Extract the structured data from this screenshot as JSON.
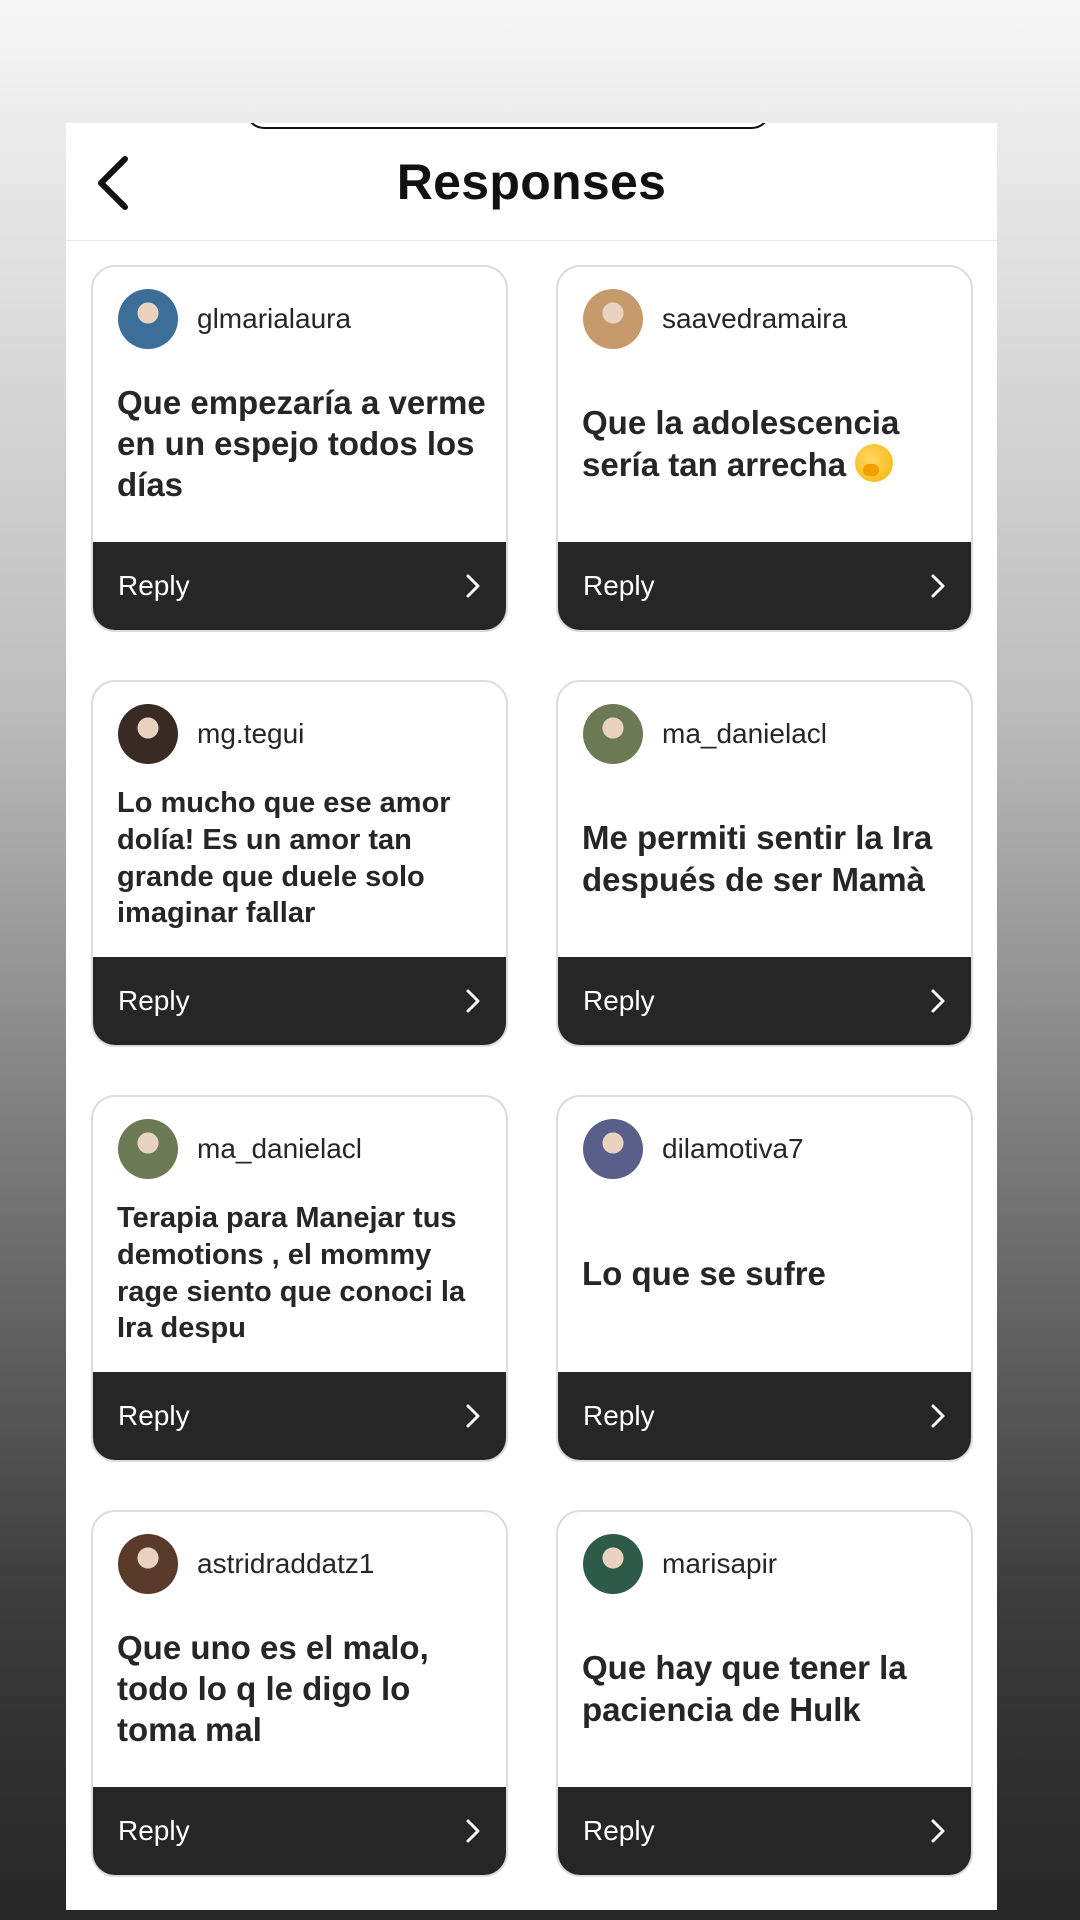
{
  "header": {
    "title": "Responses"
  },
  "responses": [
    {
      "username": "glmarialaura",
      "text": "Que empezaría a verme en un espejo todos los días",
      "size": "lg",
      "avatar_color": "#3d6e9a",
      "reply_label": "Reply"
    },
    {
      "username": "saavedramaira",
      "text": "Que la adolescencia sería tan arrecha",
      "emoji": "hand-over-mouth-emoji",
      "size": "lg",
      "avatar_color": "#c79a6c",
      "reply_label": "Reply"
    },
    {
      "username": "mg.tegui",
      "text": "Lo mucho que ese amor dolía! Es un amor tan grande que duele solo imaginar fallar",
      "size": "md",
      "avatar_color": "#3a2a24",
      "reply_label": "Reply"
    },
    {
      "username": "ma_danielacl",
      "text": "Me permiti sentir la Ira después de ser Mamà",
      "size": "lg",
      "avatar_color": "#6b7a55",
      "reply_label": "Reply"
    },
    {
      "username": "ma_danielacl",
      "text": "Terapia para Manejar tus demotions , el mommy rage siento que conoci la Ira despu",
      "size": "md",
      "avatar_color": "#6b7a55",
      "reply_label": "Reply"
    },
    {
      "username": "dilamotiva7",
      "text": "Lo que se sufre",
      "size": "lg",
      "avatar_color": "#5a5f8a",
      "reply_label": "Reply"
    },
    {
      "username": "astridraddatz1",
      "text": "Que uno es el malo, todo lo q le digo lo toma mal",
      "size": "lg",
      "avatar_color": "#5a3a2a",
      "reply_label": "Reply"
    },
    {
      "username": "marisapir",
      "text": "Que hay que tener la paciencia de Hulk",
      "size": "lg",
      "avatar_color": "#2e5a4a",
      "reply_label": "Reply"
    }
  ]
}
